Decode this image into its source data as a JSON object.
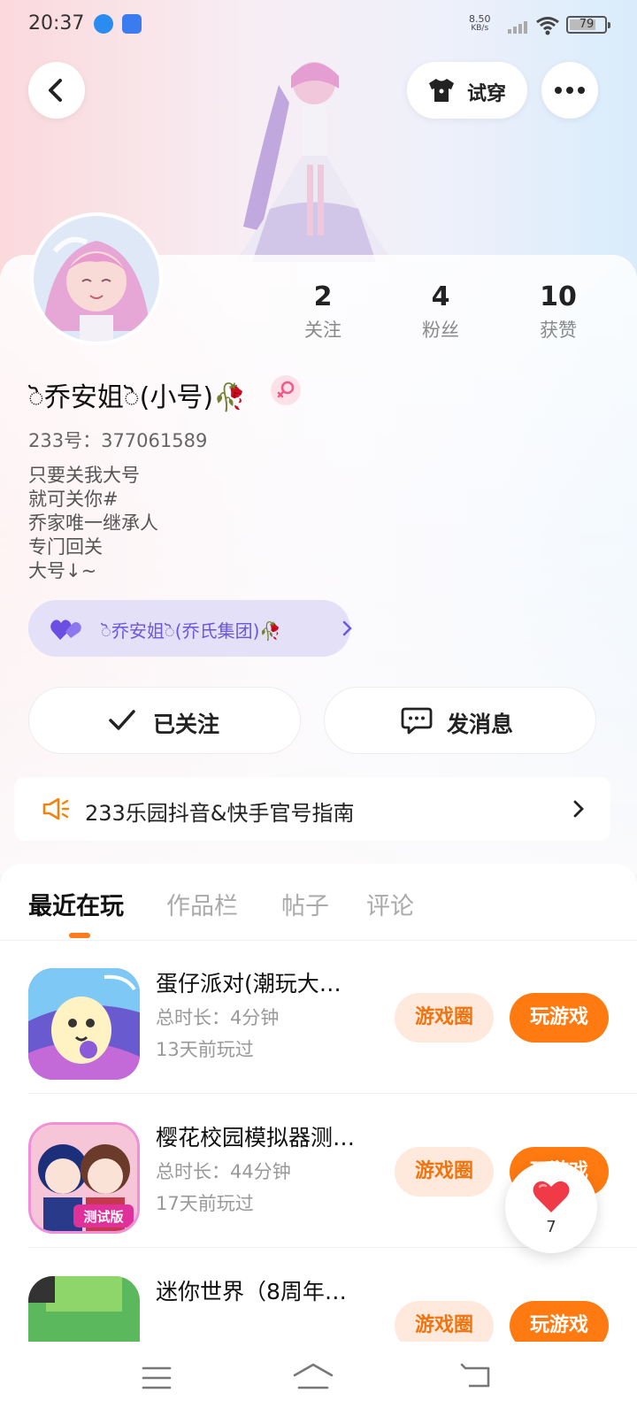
{
  "status_bar": {
    "time": "20:37",
    "net_speed_value": "8.50",
    "net_speed_unit": "KB/s",
    "battery": "79"
  },
  "header": {
    "try_on_label": "试穿"
  },
  "profile": {
    "stats": [
      {
        "count": "2",
        "label": "关注"
      },
      {
        "count": "4",
        "label": "粉丝"
      },
      {
        "count": "10",
        "label": "获赞"
      }
    ],
    "name": "ॆ乔安姐ॆ(小号)🥀",
    "id_text": "233号：377061589",
    "bio": [
      "只要关我大号",
      "就可关你#",
      "乔家唯一继承人",
      "专门回关",
      "大号↓~"
    ],
    "family_label": "ॆ乔安姐ॆ(乔氏集团)🥀"
  },
  "actions": {
    "follow_label": "已关注",
    "message_label": "发消息"
  },
  "notice": {
    "text": "233乐园抖音&快手官号指南"
  },
  "tabs": [
    "最近在玩",
    "作品栏",
    "帖子",
    "评论"
  ],
  "games": [
    {
      "title": "蛋仔派对(潮玩大…",
      "duration": "总时长：4分钟",
      "last_played": "13天前玩过",
      "circle_label": "游戏圈",
      "play_label": "玩游戏"
    },
    {
      "title": "樱花校园模拟器测…",
      "duration": "总时长：44分钟",
      "last_played": "17天前玩过",
      "circle_label": "游戏圈",
      "play_label": "玩游戏"
    },
    {
      "title": "迷你世界（8周年…",
      "duration": "",
      "last_played": "",
      "circle_label": "游戏圈",
      "play_label": "玩游戏"
    }
  ],
  "game_icon_text": {
    "game2": "测试版"
  },
  "like_bubble": {
    "count": "7"
  },
  "colors": {
    "accent": "#ff7a10",
    "family": "#6b58d8",
    "accent_light": "#ffe8dc"
  }
}
